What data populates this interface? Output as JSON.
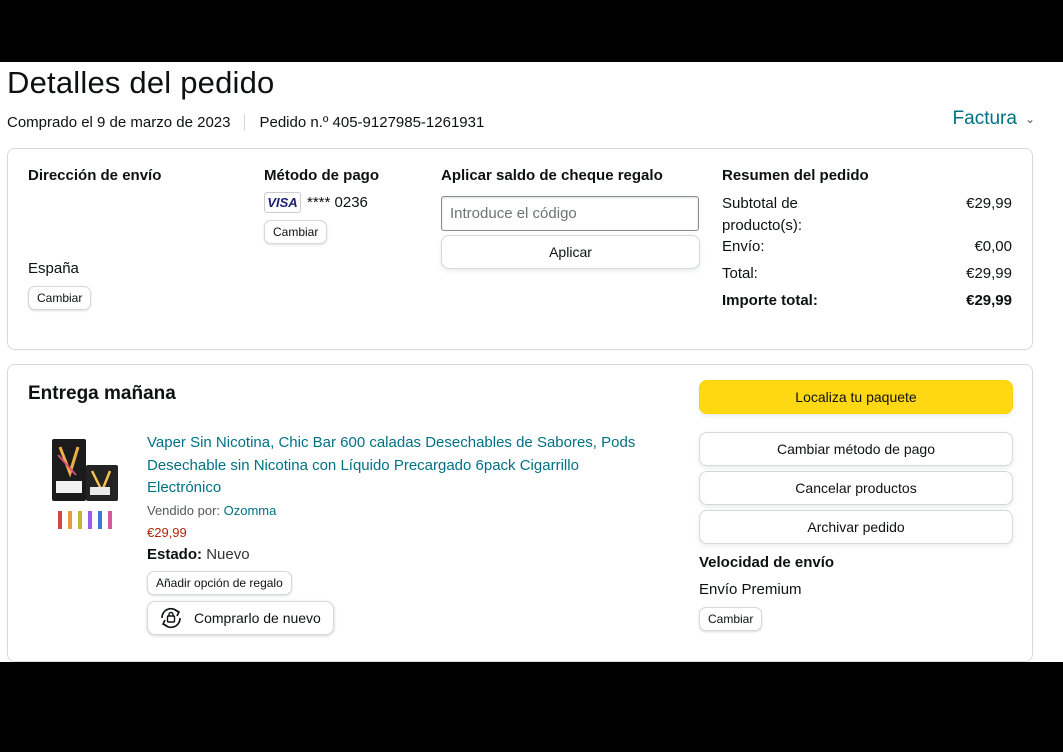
{
  "header": {
    "title": "Detalles del pedido",
    "purchased": "Comprado el 9 de marzo de 2023",
    "order_number": "Pedido n.º 405-9127985-1261931",
    "invoice_label": "Factura"
  },
  "shipping_address": {
    "heading": "Dirección de envío",
    "country": "España",
    "change_label": "Cambiar"
  },
  "payment_method": {
    "heading": "Método de pago",
    "card_brand": "VISA",
    "card_digits": "**** 0236",
    "change_label": "Cambiar"
  },
  "gift_card": {
    "heading": "Aplicar saldo de cheque regalo",
    "placeholder": "Introduce el código",
    "apply_label": "Aplicar"
  },
  "summary": {
    "heading": "Resumen del pedido",
    "subtotal_label": "Subtotal de producto(s):",
    "subtotal_value": "€29,99",
    "shipping_label": "Envío:",
    "shipping_value": "€0,00",
    "total_label": "Total:",
    "total_value": "€29,99",
    "grand_total_label": "Importe total:",
    "grand_total_value": "€29,99"
  },
  "delivery": {
    "heading": "Entrega mañana",
    "product_title": "Vaper Sin Nicotina, Chic Bar 600 caladas Desechables de Sabores, Pods Desechable sin Nicotina con Líquido Precargado 6pack Cigarrillo Electrónico",
    "sold_by_label": "Vendido por:",
    "seller": "Ozomma",
    "price": "€29,99",
    "condition_label": "Estado:",
    "condition_value": "Nuevo",
    "gift_option_label": "Añadir opción de regalo",
    "buy_again_label": "Comprarlo de nuevo"
  },
  "actions": {
    "track_label": "Localiza tu paquete",
    "change_payment_label": "Cambiar método de pago",
    "cancel_label": "Cancelar productos",
    "archive_label": "Archivar pedido",
    "speed_heading": "Velocidad de envío",
    "speed_value": "Envío Premium",
    "speed_change_label": "Cambiar"
  },
  "colors": {
    "link": "#007185",
    "price": "#b12704",
    "primary_button": "#ffd814"
  }
}
